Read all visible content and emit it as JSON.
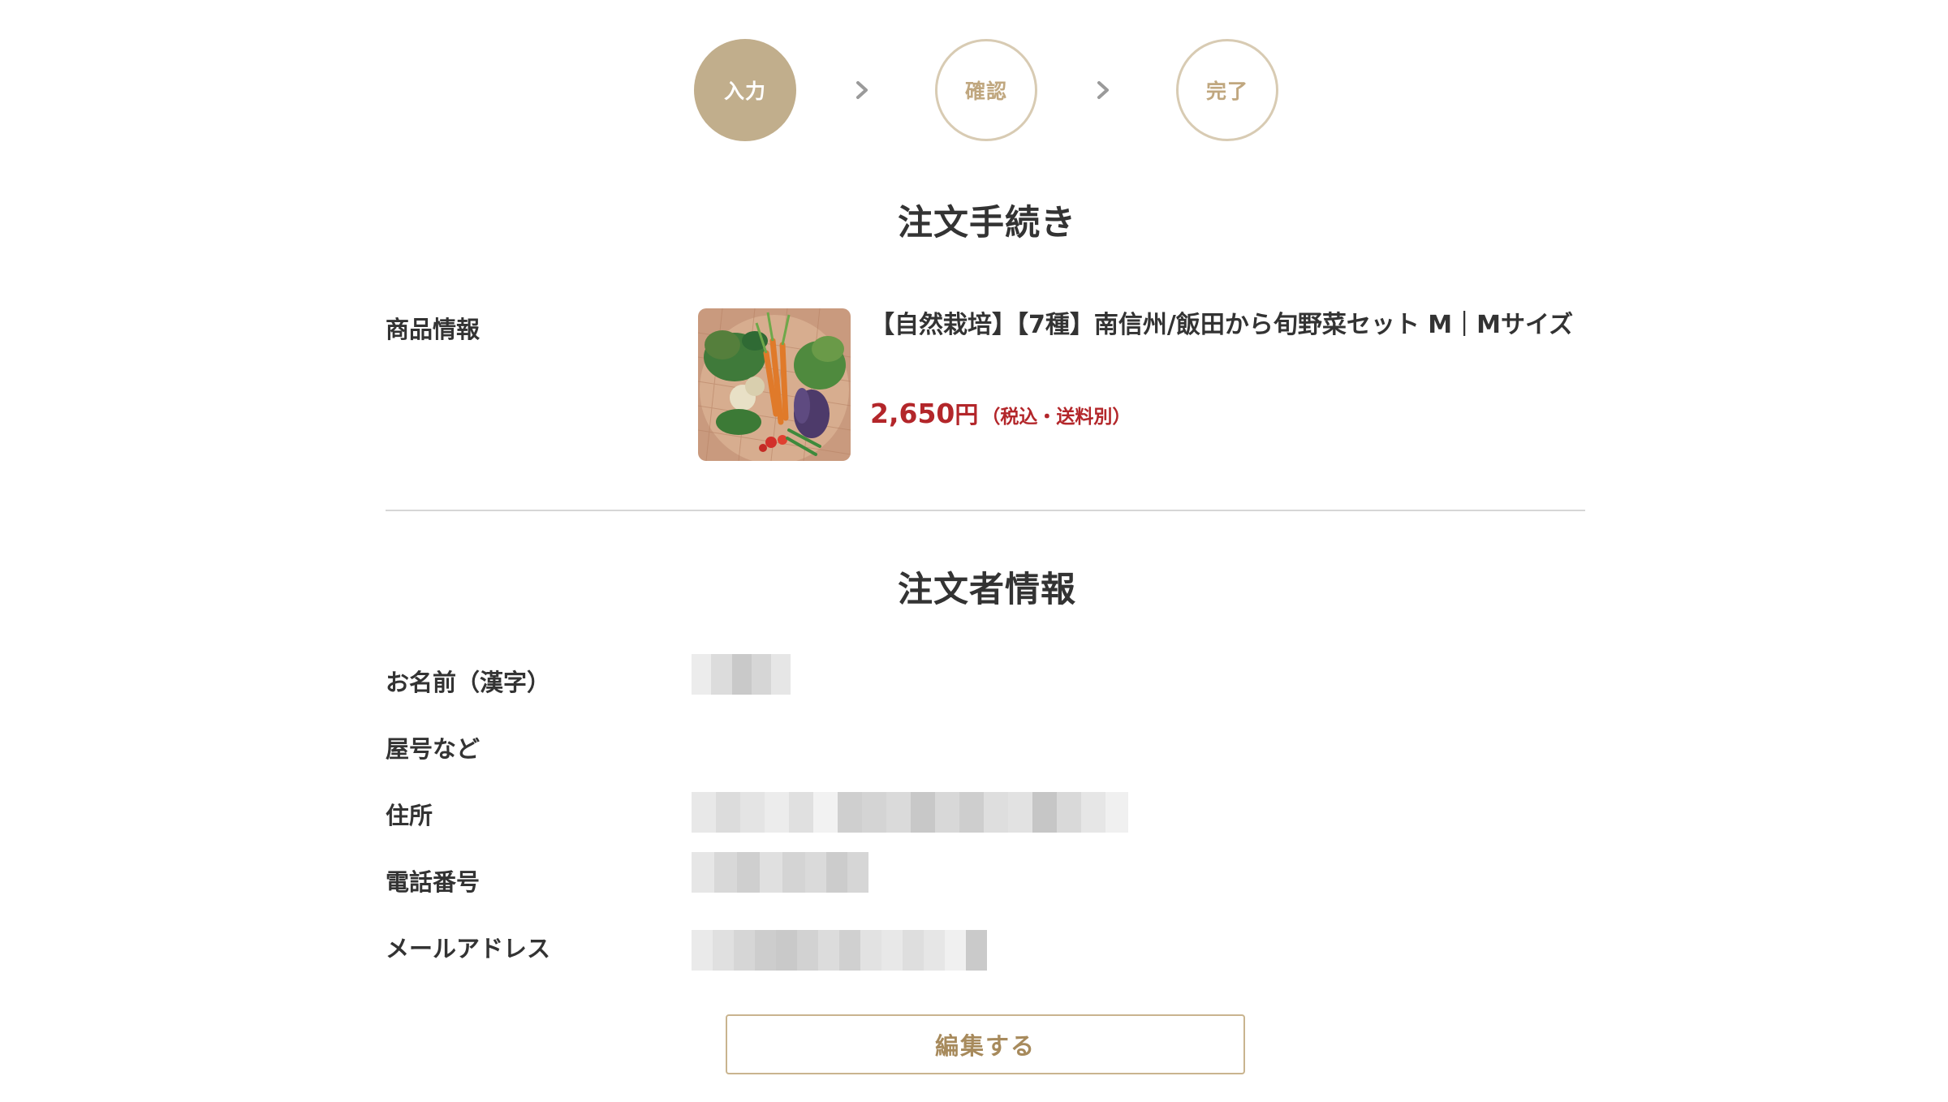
{
  "stepper": {
    "steps": [
      {
        "label": "入力",
        "state": "active"
      },
      {
        "label": "確認",
        "state": "inactive"
      },
      {
        "label": "完了",
        "state": "inactive"
      }
    ],
    "active_color": "#c1ae8c",
    "inactive_border_color": "#d8cbb3"
  },
  "order_section": {
    "title": "注文手続き",
    "product_label": "商品情報",
    "product": {
      "name": "【自然栽培】【7種】南信州/飯田から旬野菜セット M｜Mサイズ",
      "price_number": "2,650",
      "price_unit": "円",
      "price_note": "（税込・送料別）",
      "price_color": "#b3262a",
      "thumbnail": "vegetable-basket-photo"
    }
  },
  "customer_section": {
    "title": "注文者情報",
    "fields": [
      {
        "label": "お名前（漢字）",
        "value_state": "pixelated"
      },
      {
        "label": "屋号など",
        "value_state": "empty"
      },
      {
        "label": "住所",
        "value_state": "pixelated"
      },
      {
        "label": "電話番号",
        "value_state": "pixelated"
      },
      {
        "label": "メールアドレス",
        "value_state": "pixelated"
      }
    ]
  },
  "actions": {
    "edit_label": "編集する"
  }
}
